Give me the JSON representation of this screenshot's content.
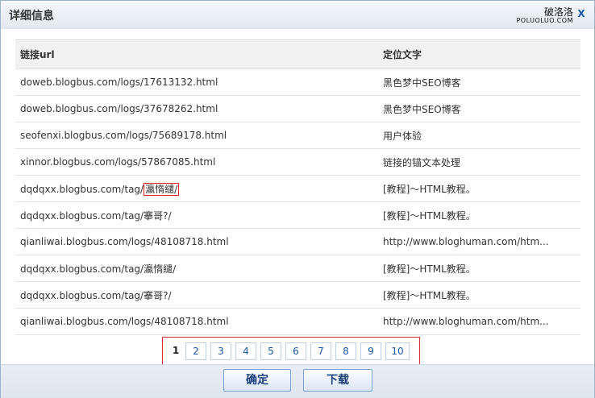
{
  "dialog": {
    "title": "详细信息"
  },
  "watermark": {
    "text": "破洛洛",
    "sub": "POLUOLUO.COM"
  },
  "close_glyph": "X",
  "table": {
    "headers": {
      "url": "链接url",
      "anchor": "定位文字"
    },
    "rows": [
      {
        "url": "doweb.blogbus.com/logs/17613132.html",
        "anchor": "黑色梦中SEO博客"
      },
      {
        "url": "doweb.blogbus.com/logs/37678262.html",
        "anchor": "黑色梦中SEO博客"
      },
      {
        "url": "seofenxi.blogbus.com/logs/75689178.html",
        "anchor": "用户体验"
      },
      {
        "url": "xinnor.blogbus.com/logs/57867085.html",
        "anchor": "链接的锚文本处理"
      },
      {
        "url_prefix": "dqdqxx.blogbus.com/tag/",
        "url_highlight": "瀛惰繾/",
        "anchor": "[教程]～HTML教程。"
      },
      {
        "url": "dqdqxx.blogbus.com/tag/搴哥?/",
        "anchor": "[教程]～HTML教程。"
      },
      {
        "url": "qianliwai.blogbus.com/logs/48108718.html",
        "anchor": "http://www.bloghuman.com/htm..."
      },
      {
        "url": "dqdqxx.blogbus.com/tag/瀛惰繾/",
        "anchor": "[教程]～HTML教程。"
      },
      {
        "url": "dqdqxx.blogbus.com/tag/搴哥?/",
        "anchor": "[教程]～HTML教程。"
      },
      {
        "url": "qianliwai.blogbus.com/logs/48108718.html",
        "anchor": "http://www.bloghuman.com/htm..."
      }
    ]
  },
  "pagination": {
    "current": "1",
    "pages": [
      "1",
      "2",
      "3",
      "4",
      "5",
      "6",
      "7",
      "8",
      "9",
      "10"
    ]
  },
  "buttons": {
    "confirm": "确定",
    "download": "下载"
  },
  "colors": {
    "accent": "#1a56a8",
    "highlight_border": "#e02020",
    "pager_border": "#d32d2d"
  }
}
